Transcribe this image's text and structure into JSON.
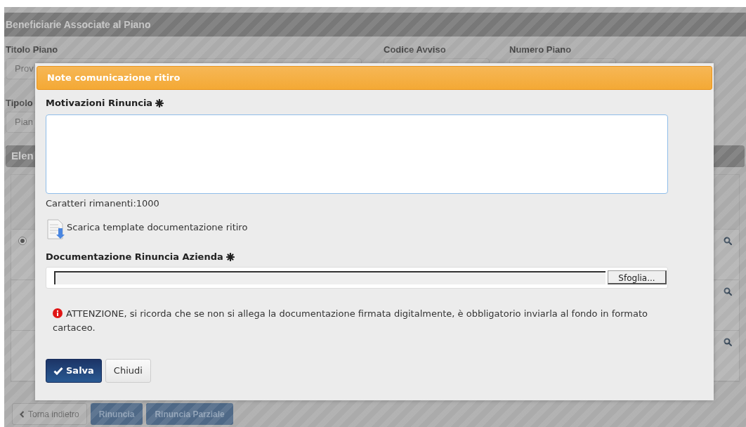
{
  "page": {
    "section_title": "Beneficiarie Associate al Piano",
    "fields": [
      {
        "label": "Titolo Piano",
        "value": "Prov"
      },
      {
        "label": "Codice Avviso"
      },
      {
        "label": "Numero Piano"
      },
      {
        "label": "Tipolo",
        "value": "Pian"
      }
    ],
    "list_title": "Elen",
    "rows": [
      {
        "kind": "radio",
        "selected": true
      },
      {
        "kind": "plain",
        "selected": false
      },
      {
        "kind": "plain",
        "selected": false
      }
    ],
    "buttons": [
      {
        "label": "Torna indietro",
        "kind": "back"
      },
      {
        "label": "Rinuncia",
        "kind": "primary"
      },
      {
        "label": "Rinuncia Parziale",
        "kind": "primary"
      }
    ]
  },
  "dialog": {
    "title": "Note comunicazione ritiro",
    "reason_label": "Motivazioni Rinuncia",
    "reason_required": true,
    "counter": "Caratteri rimanenti:1000",
    "download_link": "Scarica template documentazione ritiro",
    "file_label": "Documentazione Rinuncia Azienda",
    "file_required": true,
    "browse_button": "Sfoglia...",
    "alert": "ATTENZIONE, si ricorda che se non si allega la documentazione firmata digitalmente, è obbligatorio inviarla al fondo in formato cartaceo.",
    "buttons": [
      {
        "label": "Salva",
        "kind": "primary"
      },
      {
        "label": "Chiudi",
        "kind": "default"
      }
    ]
  }
}
